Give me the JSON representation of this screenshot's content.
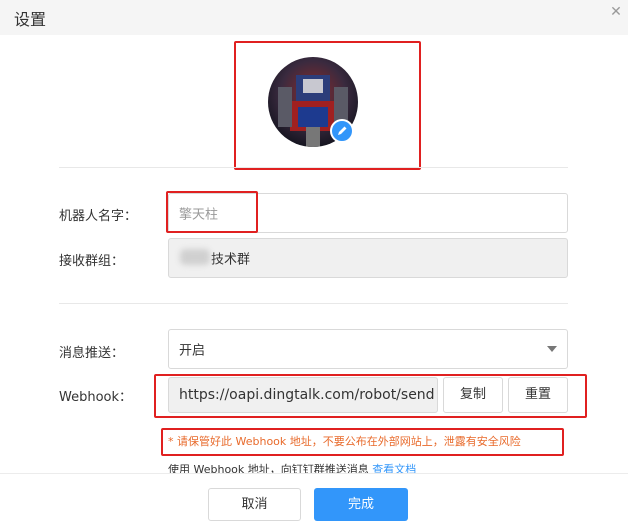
{
  "dialog": {
    "title": "设置"
  },
  "avatar": {
    "edit_icon": "pencil-icon"
  },
  "form": {
    "robot_name": {
      "label": "机器人名字：",
      "value": "擎天柱"
    },
    "group": {
      "label": "接收群组：",
      "value": "技术群"
    },
    "push": {
      "label": "消息推送：",
      "value": "开启"
    },
    "webhook": {
      "label": "Webhook：",
      "value": "https://oapi.dingtalk.com/robot/send",
      "copy_label": "复制",
      "reset_label": "重置",
      "warning": "* 请保管好此 Webhook 地址，不要公布在外部网站上，泄露有安全风险",
      "hint": "使用 Webhook 地址，向钉钉群推送消息",
      "doc_link": "查看文档"
    }
  },
  "footer": {
    "cancel_label": "取消",
    "ok_label": "完成"
  },
  "colors": {
    "accent": "#3296fa",
    "highlight": "#e02020",
    "warning": "#e86a2b"
  }
}
